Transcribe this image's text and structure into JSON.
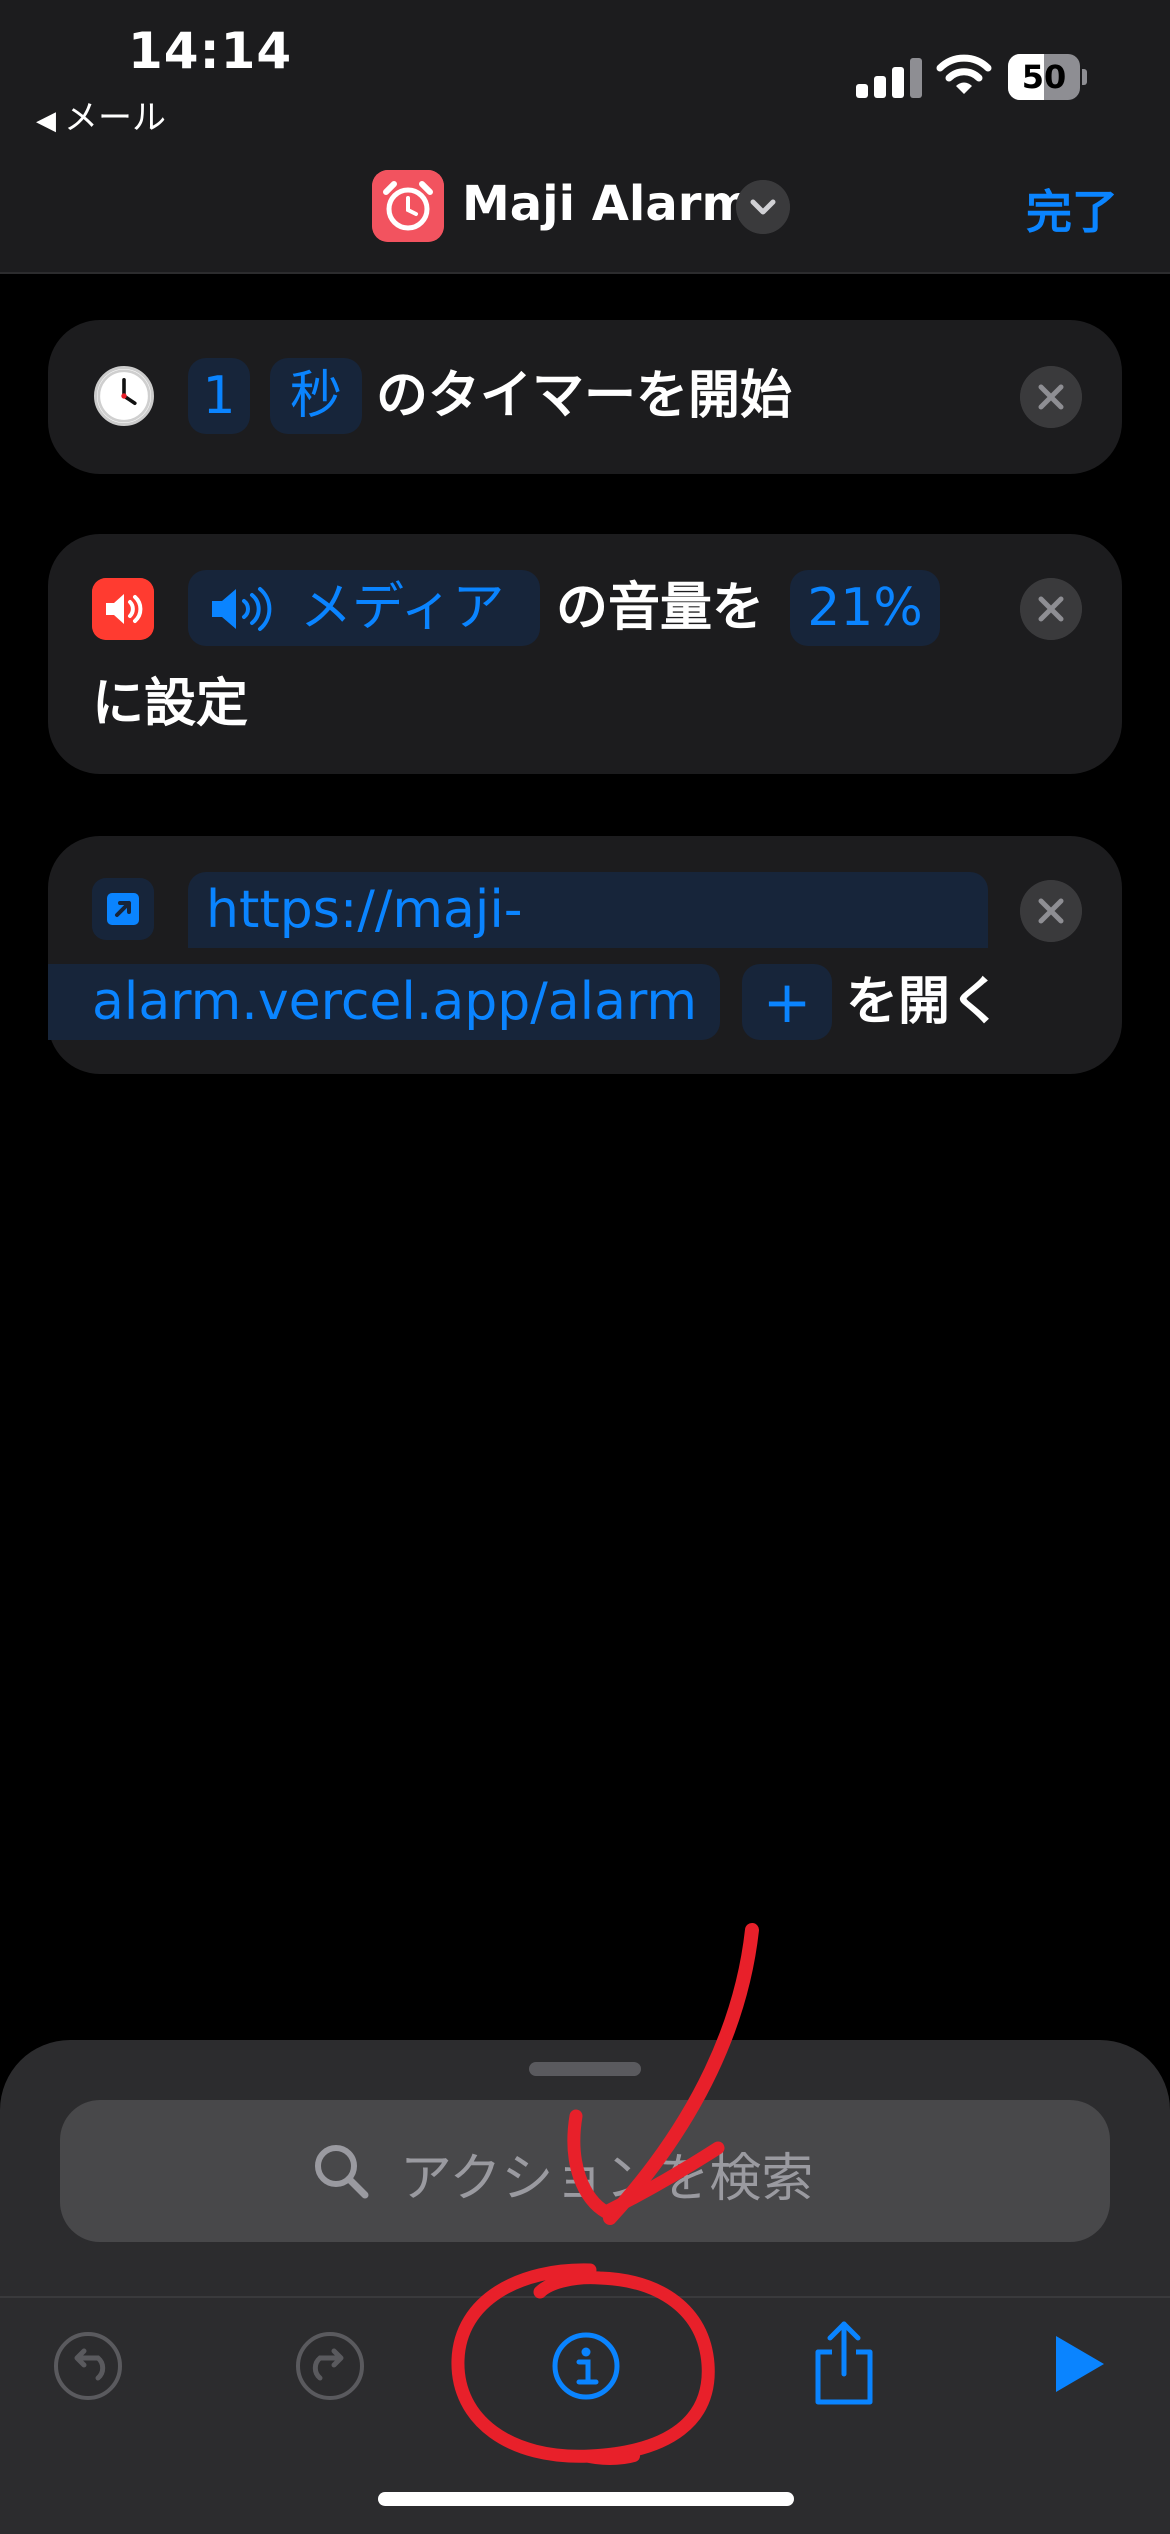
{
  "status_bar": {
    "time": "14:14",
    "back_label": "メール",
    "battery_percent": "50",
    "battery_level": 0.5
  },
  "nav": {
    "title": "Maji Alarm",
    "done_label": "完了",
    "app_icon": "alarm-clock-icon"
  },
  "actions": [
    {
      "icon": "clock-icon",
      "value": "1",
      "unit": "秒",
      "text": "のタイマーを開始"
    },
    {
      "icon": "speaker-icon",
      "target": "メディア",
      "text1": "の音量を",
      "value": "21%",
      "text2": "に設定"
    },
    {
      "icon": "link-icon",
      "url_line1": "https://maji-",
      "url_line2": "alarm.vercel.app/alarm",
      "add_symbol": "+",
      "text": "を開く"
    }
  ],
  "search": {
    "placeholder": "アクションを検索"
  },
  "toolbar": {
    "items": [
      "undo-icon",
      "redo-icon",
      "info-icon",
      "share-icon",
      "play-icon"
    ]
  },
  "colors": {
    "accent": "#0a84ff",
    "annotation": "#e8202a",
    "card_bg": "#1c1c1e"
  }
}
